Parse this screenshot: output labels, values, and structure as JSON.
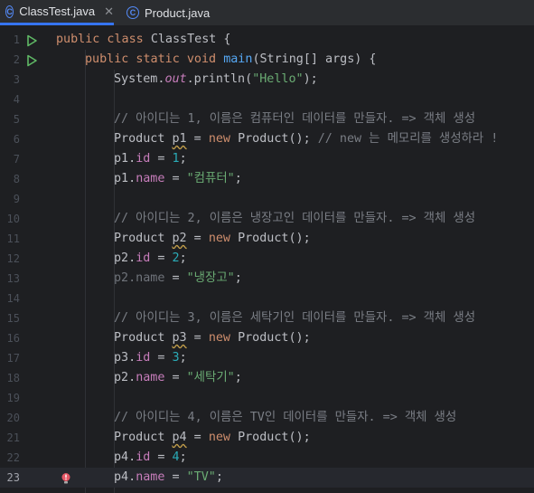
{
  "tabs": [
    {
      "name": "ClassTest.java",
      "icon": "java-class-icon",
      "active": true
    },
    {
      "name": "Product.java",
      "icon": "java-class-icon",
      "active": false
    }
  ],
  "lines": [
    {
      "n": "1",
      "gutter": "run-icon",
      "indent": 0,
      "tokens": [
        [
          "kw",
          "public class "
        ],
        [
          "",
          "ClassTest {"
        ]
      ]
    },
    {
      "n": "2",
      "gutter": "run-icon",
      "indent": 1,
      "tokens": [
        [
          "kw",
          "public static void "
        ],
        [
          "fn",
          "main"
        ],
        [
          "",
          "(String[] args) {"
        ]
      ]
    },
    {
      "n": "3",
      "indent": 2,
      "tokens": [
        [
          "",
          "System."
        ],
        [
          "st",
          "out"
        ],
        [
          "",
          ".println("
        ],
        [
          "str",
          "\"Hello\""
        ],
        [
          "",
          ");"
        ]
      ]
    },
    {
      "n": "4",
      "indent": 2,
      "tokens": []
    },
    {
      "n": "5",
      "indent": 2,
      "tokens": [
        [
          "cm",
          "// 아이디는 1, 이름은 컴퓨터인 데이터를 만들자. => 객체 생성"
        ]
      ]
    },
    {
      "n": "6",
      "indent": 2,
      "tokens": [
        [
          "",
          "Product "
        ],
        [
          "wavy",
          "p1"
        ],
        [
          "",
          " = "
        ],
        [
          "kw",
          "new "
        ],
        [
          "",
          "Product(); "
        ],
        [
          "cm",
          "// new 는 메모리를 생성하라 !"
        ]
      ]
    },
    {
      "n": "7",
      "indent": 2,
      "tokens": [
        [
          "",
          "p1."
        ],
        [
          "fld",
          "id"
        ],
        [
          "",
          " = "
        ],
        [
          "num",
          "1"
        ],
        [
          "",
          ";"
        ]
      ]
    },
    {
      "n": "8",
      "indent": 2,
      "tokens": [
        [
          "",
          "p1."
        ],
        [
          "fld",
          "name"
        ],
        [
          "",
          " = "
        ],
        [
          "str",
          "\"컴퓨터\""
        ],
        [
          "",
          ";"
        ]
      ]
    },
    {
      "n": "9",
      "indent": 2,
      "tokens": []
    },
    {
      "n": "10",
      "indent": 2,
      "tokens": [
        [
          "cm",
          "// 아이디는 2, 이름은 냉장고인 데이터를 만들자. => 객체 생성"
        ]
      ]
    },
    {
      "n": "11",
      "indent": 2,
      "tokens": [
        [
          "",
          "Product "
        ],
        [
          "wavy",
          "p2"
        ],
        [
          "",
          " = "
        ],
        [
          "kw",
          "new "
        ],
        [
          "",
          "Product();"
        ]
      ]
    },
    {
      "n": "12",
      "indent": 2,
      "tokens": [
        [
          "",
          "p2."
        ],
        [
          "fld",
          "id"
        ],
        [
          "",
          " = "
        ],
        [
          "num",
          "2"
        ],
        [
          "",
          ";"
        ]
      ]
    },
    {
      "n": "13",
      "indent": 2,
      "tokens": [
        [
          "dim",
          "p2.name"
        ],
        [
          "",
          " = "
        ],
        [
          "str",
          "\"냉장고\""
        ],
        [
          "",
          ";"
        ]
      ]
    },
    {
      "n": "14",
      "indent": 2,
      "tokens": []
    },
    {
      "n": "15",
      "indent": 2,
      "tokens": [
        [
          "cm",
          "// 아이디는 3, 이름은 세탁기인 데이터를 만들자. => 객체 생성"
        ]
      ]
    },
    {
      "n": "16",
      "indent": 2,
      "tokens": [
        [
          "",
          "Product "
        ],
        [
          "wavy",
          "p3"
        ],
        [
          "",
          " = "
        ],
        [
          "kw",
          "new "
        ],
        [
          "",
          "Product();"
        ]
      ]
    },
    {
      "n": "17",
      "indent": 2,
      "tokens": [
        [
          "",
          "p3."
        ],
        [
          "fld",
          "id"
        ],
        [
          "",
          " = "
        ],
        [
          "num",
          "3"
        ],
        [
          "",
          ";"
        ]
      ]
    },
    {
      "n": "18",
      "indent": 2,
      "tokens": [
        [
          "",
          "p2."
        ],
        [
          "fld",
          "name"
        ],
        [
          "",
          " = "
        ],
        [
          "str",
          "\"세탁기\""
        ],
        [
          "",
          ";"
        ]
      ]
    },
    {
      "n": "19",
      "indent": 2,
      "tokens": []
    },
    {
      "n": "20",
      "indent": 2,
      "tokens": [
        [
          "cm",
          "// 아이디는 4, 이름은 TV인 데이터를 만들자. => 객체 생성"
        ]
      ]
    },
    {
      "n": "21",
      "indent": 2,
      "tokens": [
        [
          "",
          "Product "
        ],
        [
          "wavy",
          "p4"
        ],
        [
          "",
          " = "
        ],
        [
          "kw",
          "new "
        ],
        [
          "",
          "Product();"
        ]
      ]
    },
    {
      "n": "22",
      "indent": 2,
      "tokens": [
        [
          "",
          "p4."
        ],
        [
          "fld",
          "id"
        ],
        [
          "",
          " = "
        ],
        [
          "num",
          "4"
        ],
        [
          "",
          ";"
        ]
      ]
    },
    {
      "n": "23",
      "gutter": "bulb-error-icon",
      "current": true,
      "indent": 2,
      "tokens": [
        [
          "",
          "p4."
        ],
        [
          "fld",
          "name"
        ],
        [
          "",
          " = "
        ],
        [
          "str",
          "\"TV\""
        ],
        [
          "",
          ";"
        ]
      ]
    }
  ],
  "colors": {
    "background": "#1e1f22",
    "keyword": "#cf8e6d",
    "method": "#56a8f5",
    "field": "#c77dbb",
    "string": "#6aab73",
    "number": "#2aacb8",
    "comment": "#7a7e85",
    "run_icon": "#5fb865",
    "error_icon": "#e55765",
    "active_tab": "#3574f0"
  }
}
